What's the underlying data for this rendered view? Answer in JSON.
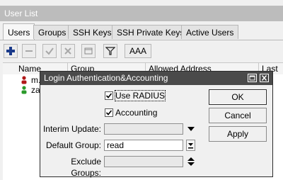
{
  "window": {
    "title": "User List",
    "tabs": [
      "Users",
      "Groups",
      "SSH Keys",
      "SSH Private Keys",
      "Active Users"
    ],
    "active_tab": "Users",
    "toolbar": {
      "aaa_label": "AAA"
    },
    "columns": [
      "Name",
      "Group",
      "Allowed Address",
      "Last Lo"
    ],
    "rows": [
      {
        "name": "m.s",
        "icon_color": "#b01818"
      },
      {
        "name": "za",
        "icon_color": "#2a9a2a"
      }
    ]
  },
  "dialog": {
    "title": "Login Authentication&Accounting",
    "use_radius": {
      "label": "Use RADIUS",
      "checked": true
    },
    "accounting": {
      "label": "Accounting",
      "checked": true
    },
    "interim_update": {
      "label": "Interim Update:",
      "value": ""
    },
    "default_group": {
      "label": "Default Group:",
      "value": "read"
    },
    "exclude_groups": {
      "label": "Exclude Groups:",
      "value": ""
    },
    "buttons": {
      "ok": "OK",
      "cancel": "Cancel",
      "apply": "Apply"
    }
  },
  "colors": {
    "title_inactive": "#bcbcbc",
    "dialog_title": "#4a4a4a",
    "add_icon": "#1a3a8a"
  }
}
